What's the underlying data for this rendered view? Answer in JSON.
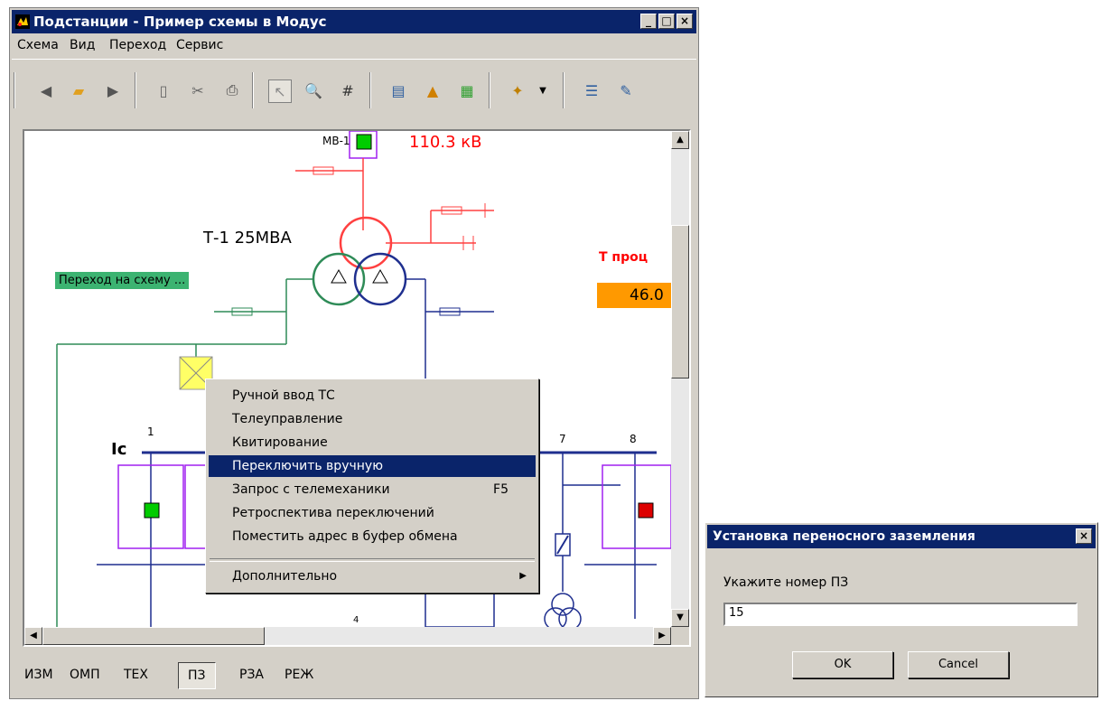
{
  "window": {
    "title": "Подстанции - Пример схемы в Модус"
  },
  "menu": [
    "Схема",
    "Вид",
    "Переход",
    "Сервис"
  ],
  "schematic": {
    "switch_label": "МВ-1",
    "voltage": "110.3 кВ",
    "transformer": "Т-1  25МВА",
    "goto_button": "Переход на схему ...",
    "temp_label": "Т проц",
    "temp_value": "46.0",
    "bus_label": "Iс",
    "feeders": [
      "1",
      "7",
      "8",
      "4"
    ]
  },
  "context_menu": {
    "items": [
      {
        "label": "Ручной ввод ТС",
        "shortcut": ""
      },
      {
        "label": "Телеуправление",
        "shortcut": ""
      },
      {
        "label": "Квитирование",
        "shortcut": ""
      },
      {
        "label": "Переключить вручную",
        "shortcut": ""
      },
      {
        "label": "Запрос  с телемеханики",
        "shortcut": "F5"
      },
      {
        "label": "Ретроспектива переключений",
        "shortcut": ""
      },
      {
        "label": "Поместить адрес в буфер обмена",
        "shortcut": ""
      }
    ],
    "more": "Дополнительно"
  },
  "tabs": [
    "ИЗМ",
    "ОМП",
    "ТЕХ",
    "ПЗ",
    "РЗА",
    "РЕЖ"
  ],
  "dialog": {
    "title": "Установка переносного заземления",
    "prompt": "Укажите номер ПЗ",
    "value": "15",
    "ok": "OK",
    "cancel": "Cancel"
  },
  "colors": {
    "title_bar": "#0a246a",
    "highlight": "#0a246a",
    "red": "#ff0000",
    "green": "#2e8b57",
    "blue": "#1f2f8f",
    "purple": "#a020f0",
    "orange": "#ff9900"
  }
}
